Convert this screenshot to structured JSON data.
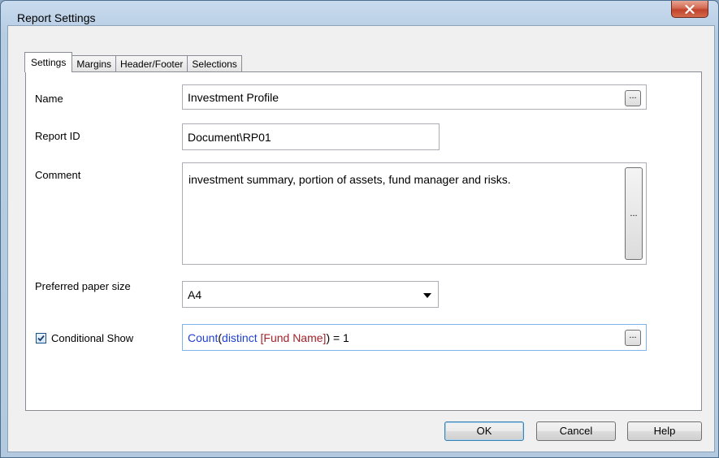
{
  "window": {
    "title": "Report Settings"
  },
  "tabs": [
    {
      "label": "Settings",
      "active": true
    },
    {
      "label": "Margins",
      "active": false
    },
    {
      "label": "Header/Footer",
      "active": false
    },
    {
      "label": "Selections",
      "active": false
    }
  ],
  "form": {
    "name": {
      "label": "Name",
      "value": "Investment Profile"
    },
    "report_id": {
      "label": "Report ID",
      "value": "Document\\RP01"
    },
    "comment": {
      "label": "Comment",
      "value": "investment summary, portion of assets, fund manager and risks."
    },
    "paper": {
      "label": "Preferred paper size",
      "value": "A4"
    },
    "conditional": {
      "label": "Conditional Show",
      "checked": true,
      "expr_func": "Count",
      "expr_open": "(",
      "expr_kw": "distinct",
      "expr_field": "[Fund Name]",
      "expr_rest": ") = 1"
    },
    "ellipsis": "..."
  },
  "buttons": {
    "ok": "OK",
    "cancel": "Cancel",
    "help": "Help"
  },
  "colors": {
    "expr_func": "#1f3fd0",
    "expr_keyword": "#1f3fd0",
    "expr_field": "#a4232a",
    "close_button": "#c84a33"
  }
}
